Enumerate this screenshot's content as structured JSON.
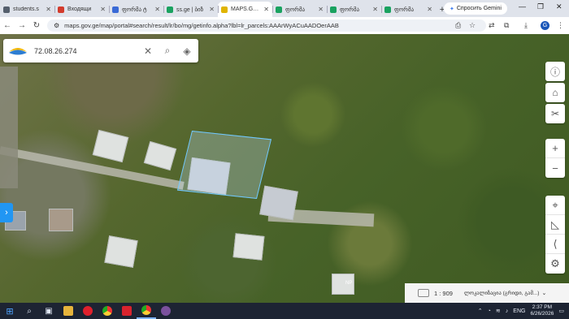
{
  "browser": {
    "tabs": [
      {
        "title": "students.s",
        "color": "#555f6d"
      },
      {
        "title": "Входящи",
        "color": "#d33b2c"
      },
      {
        "title": "ფორმა ტ",
        "color": "#3a6ad6"
      },
      {
        "title": "ss.ge | ბიზ",
        "color": "#1aa260"
      },
      {
        "title": "MAPS.GOV",
        "color": "#e0b400",
        "active": true
      },
      {
        "title": "ფორმა",
        "color": "#1aa260"
      },
      {
        "title": "ფორმა",
        "color": "#1aa260"
      },
      {
        "title": "ფორმა",
        "color": "#1aa260"
      }
    ],
    "new_tab": "+",
    "gemini_label": "Спросить Gemini",
    "url": "maps.gov.ge/map/portal#search/result/lr/bo/mg/getinfo.alpha?lbl=lr_parcels:AAArWyACuAADOerAAB"
  },
  "map": {
    "search_value": "72.08.26.274",
    "scale": "1 : 909",
    "projection_label": "ლოკალიზაცია (გრიდი, გამ...)",
    "house_label": "NP"
  },
  "taskbar": {
    "lang": "ENG",
    "time": "2:37 PM",
    "date": "6/26/2026"
  },
  "colors": {
    "parcel_outline": "#6fc8ff",
    "accent": "#2196f3"
  }
}
